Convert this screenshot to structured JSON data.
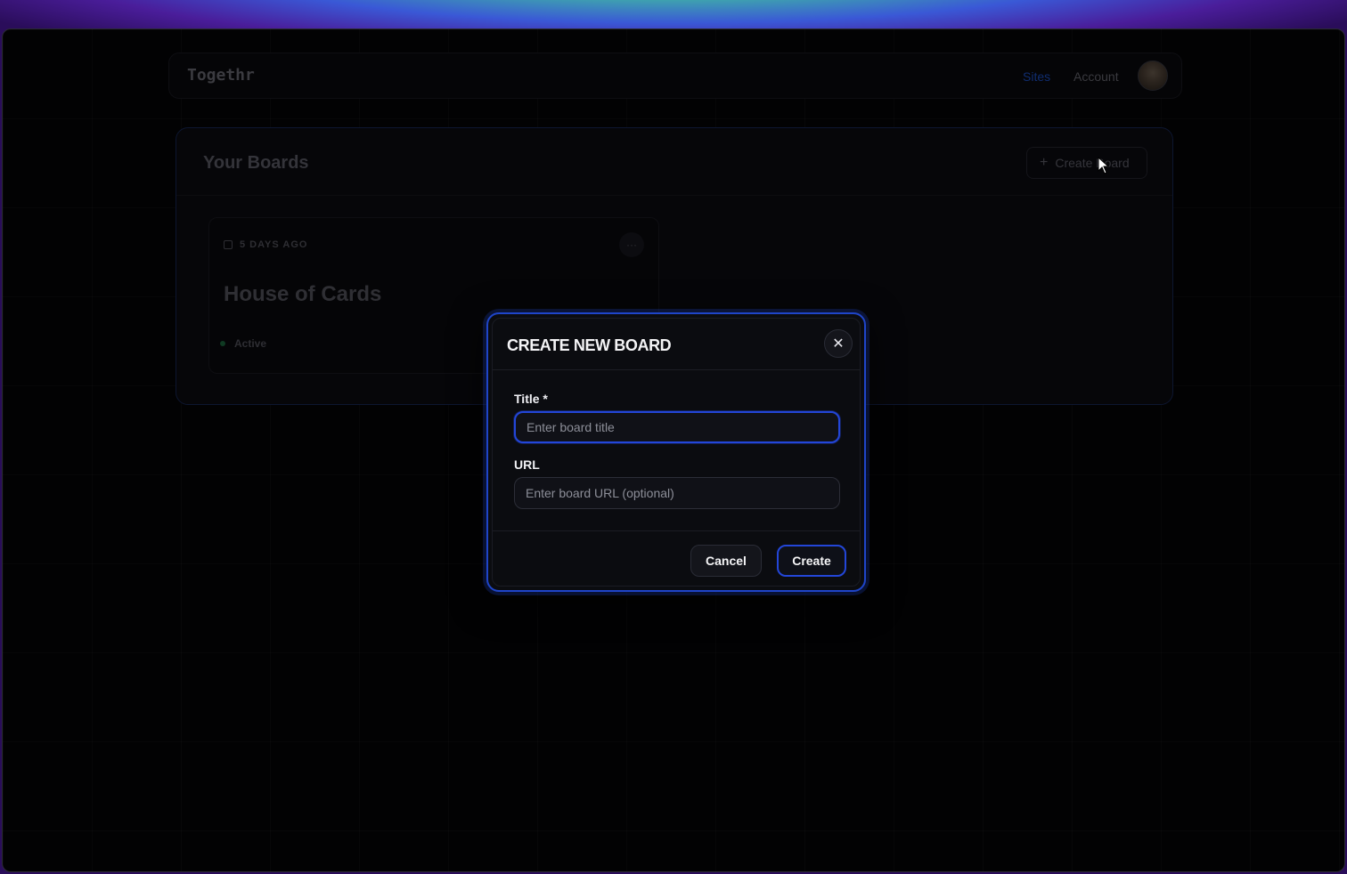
{
  "app": {
    "logo": "Togethr",
    "nav": {
      "sites": "Sites",
      "account": "Account"
    }
  },
  "boards": {
    "title": "Your Boards",
    "create_button": "Create Board",
    "cards": [
      {
        "date": "5 DAYS AGO",
        "title": "House of Cards",
        "status": "Active",
        "menu": "···"
      }
    ]
  },
  "modal": {
    "title": "CREATE NEW BOARD",
    "close_symbol": "✕",
    "title_label": "Title *",
    "title_placeholder": "Enter board title",
    "title_value": "",
    "url_label": "URL",
    "url_placeholder": "Enter board URL (optional)",
    "url_value": "",
    "cancel": "Cancel",
    "create": "Create"
  },
  "colors": {
    "accent": "#2346d8",
    "modal_bg": "#0b0c10",
    "page_bg": "#020203",
    "status_active": "#1b6b3c"
  },
  "icons": {
    "plus": "plus-icon",
    "calendar": "calendar-icon",
    "menu": "more-horizontal-icon",
    "close": "close-icon",
    "cursor": "mouse-pointer-icon"
  }
}
